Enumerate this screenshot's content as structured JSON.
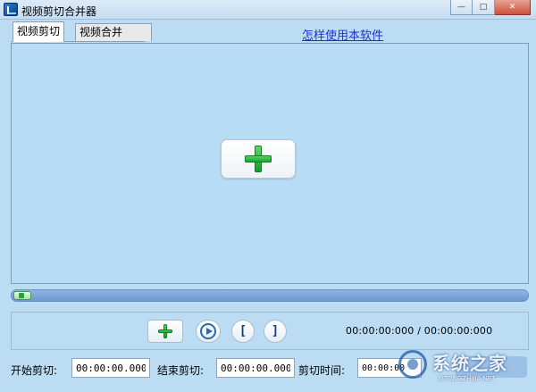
{
  "window": {
    "title": "视频剪切合并器",
    "controls": {
      "minimize": "—",
      "maximize": "□",
      "close": "✕"
    }
  },
  "tabs": [
    {
      "label": "视频剪切",
      "active": true
    },
    {
      "label": "视频合并",
      "active": false
    }
  ],
  "help_link": "怎样使用本软件",
  "player": {
    "progress": 0
  },
  "controls": {
    "start_bracket": "[",
    "end_bracket": "]",
    "time_display": "00:00:00:000 / 00:00:00:000"
  },
  "fields": {
    "start_label": "开始剪切:",
    "start_value": "00:00:00.000",
    "end_label": "结束剪切:",
    "end_value": "00:00:00.000",
    "duration_label": "剪切时间:",
    "duration_value": "00:00:00"
  },
  "watermark": {
    "text": "系统之家",
    "subtext": "XITONGZHIJIA.NET"
  },
  "icons": {
    "app": "app-icon",
    "add": "green-plus-icon",
    "play": "play-icon"
  }
}
